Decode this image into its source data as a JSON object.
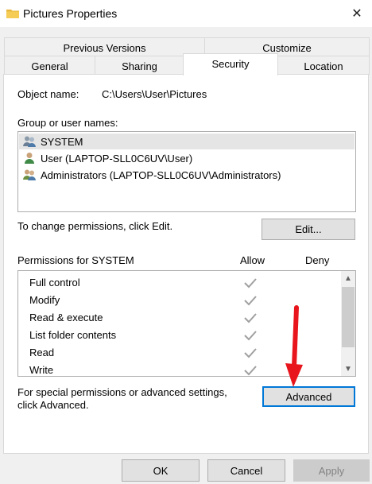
{
  "window": {
    "title": "Pictures Properties"
  },
  "tabs": {
    "row_top": [
      "Previous Versions",
      "Customize"
    ],
    "row_bottom": [
      "General",
      "Sharing",
      "Security",
      "Location"
    ]
  },
  "object": {
    "label": "Object name:",
    "value": "C:\\Users\\User\\Pictures"
  },
  "groups": {
    "label": "Group or user names:",
    "items": [
      "SYSTEM",
      "User (LAPTOP-SLL0C6UV\\User)",
      "Administrators (LAPTOP-SLL0C6UV\\Administrators)"
    ]
  },
  "change_text": "To change permissions, click Edit.",
  "edit_label": "Edit...",
  "permissions": {
    "label": "Permissions for SYSTEM",
    "allow_header": "Allow",
    "deny_header": "Deny",
    "items": [
      "Full control",
      "Modify",
      "Read & execute",
      "List folder contents",
      "Read",
      "Write"
    ]
  },
  "special": {
    "line1": "For special permissions or advanced settings,",
    "line2": "click Advanced."
  },
  "advanced_label": "Advanced",
  "footer": {
    "ok": "OK",
    "cancel": "Cancel",
    "apply": "Apply"
  },
  "colors": {
    "accent": "#0078d7",
    "arrow": "#e8161c",
    "check": "#a0a0a0"
  },
  "icons": [
    "folder-icon",
    "close-icon",
    "group-user-icon",
    "user-icon",
    "check-icon",
    "chevron-up-icon",
    "chevron-down-icon",
    "red-arrow-icon"
  ]
}
